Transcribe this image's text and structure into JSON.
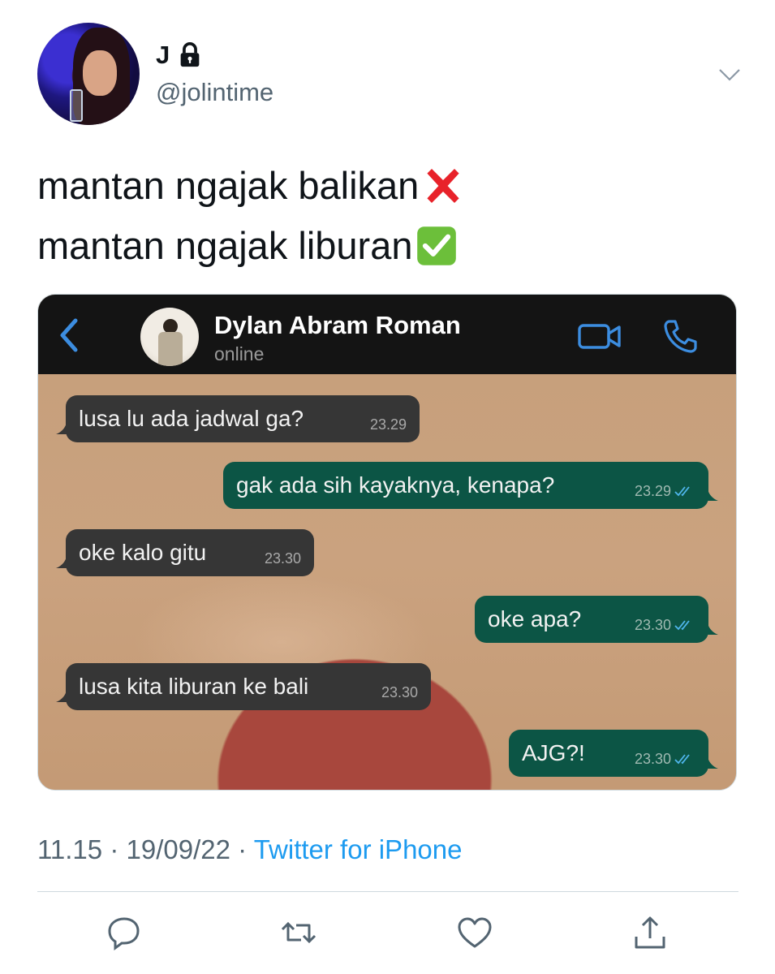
{
  "tweet": {
    "display_name": "J",
    "handle": "@jolintime",
    "lines": [
      {
        "text": "mantan ngajak balikan",
        "emoji": "cross-mark"
      },
      {
        "text": "mantan ngajak liburan",
        "emoji": "check-mark"
      }
    ],
    "time": "11.15",
    "separator": "·",
    "date": "19/09/22",
    "source": "Twitter for iPhone"
  },
  "chat": {
    "contact_name": "Dylan Abram Roman",
    "status": "online",
    "messages": [
      {
        "direction": "in",
        "text": "lusa lu ada jadwal ga?",
        "time": "23.29"
      },
      {
        "direction": "out",
        "text": "gak ada sih kayaknya, kenapa?",
        "time": "23.29",
        "read": true
      },
      {
        "direction": "in",
        "text": "oke kalo gitu",
        "time": "23.30"
      },
      {
        "direction": "out",
        "text": "oke apa?",
        "time": "23.30",
        "read": true
      },
      {
        "direction": "in",
        "text": "lusa kita liburan ke bali",
        "time": "23.30"
      },
      {
        "direction": "out",
        "text": "AJG?!",
        "time": "23.30",
        "read": true
      }
    ]
  },
  "colors": {
    "accent": "#1d9bf0",
    "muted": "#536471",
    "incoming_bubble": "#363636",
    "outgoing_bubble": "#0c5545",
    "wa_icon_blue": "#3c8de0"
  },
  "icons": [
    "lock-icon",
    "chevron-down-icon",
    "back-arrow-icon",
    "video-call-icon",
    "phone-call-icon",
    "reply-icon",
    "retweet-icon",
    "like-icon",
    "share-icon"
  ]
}
